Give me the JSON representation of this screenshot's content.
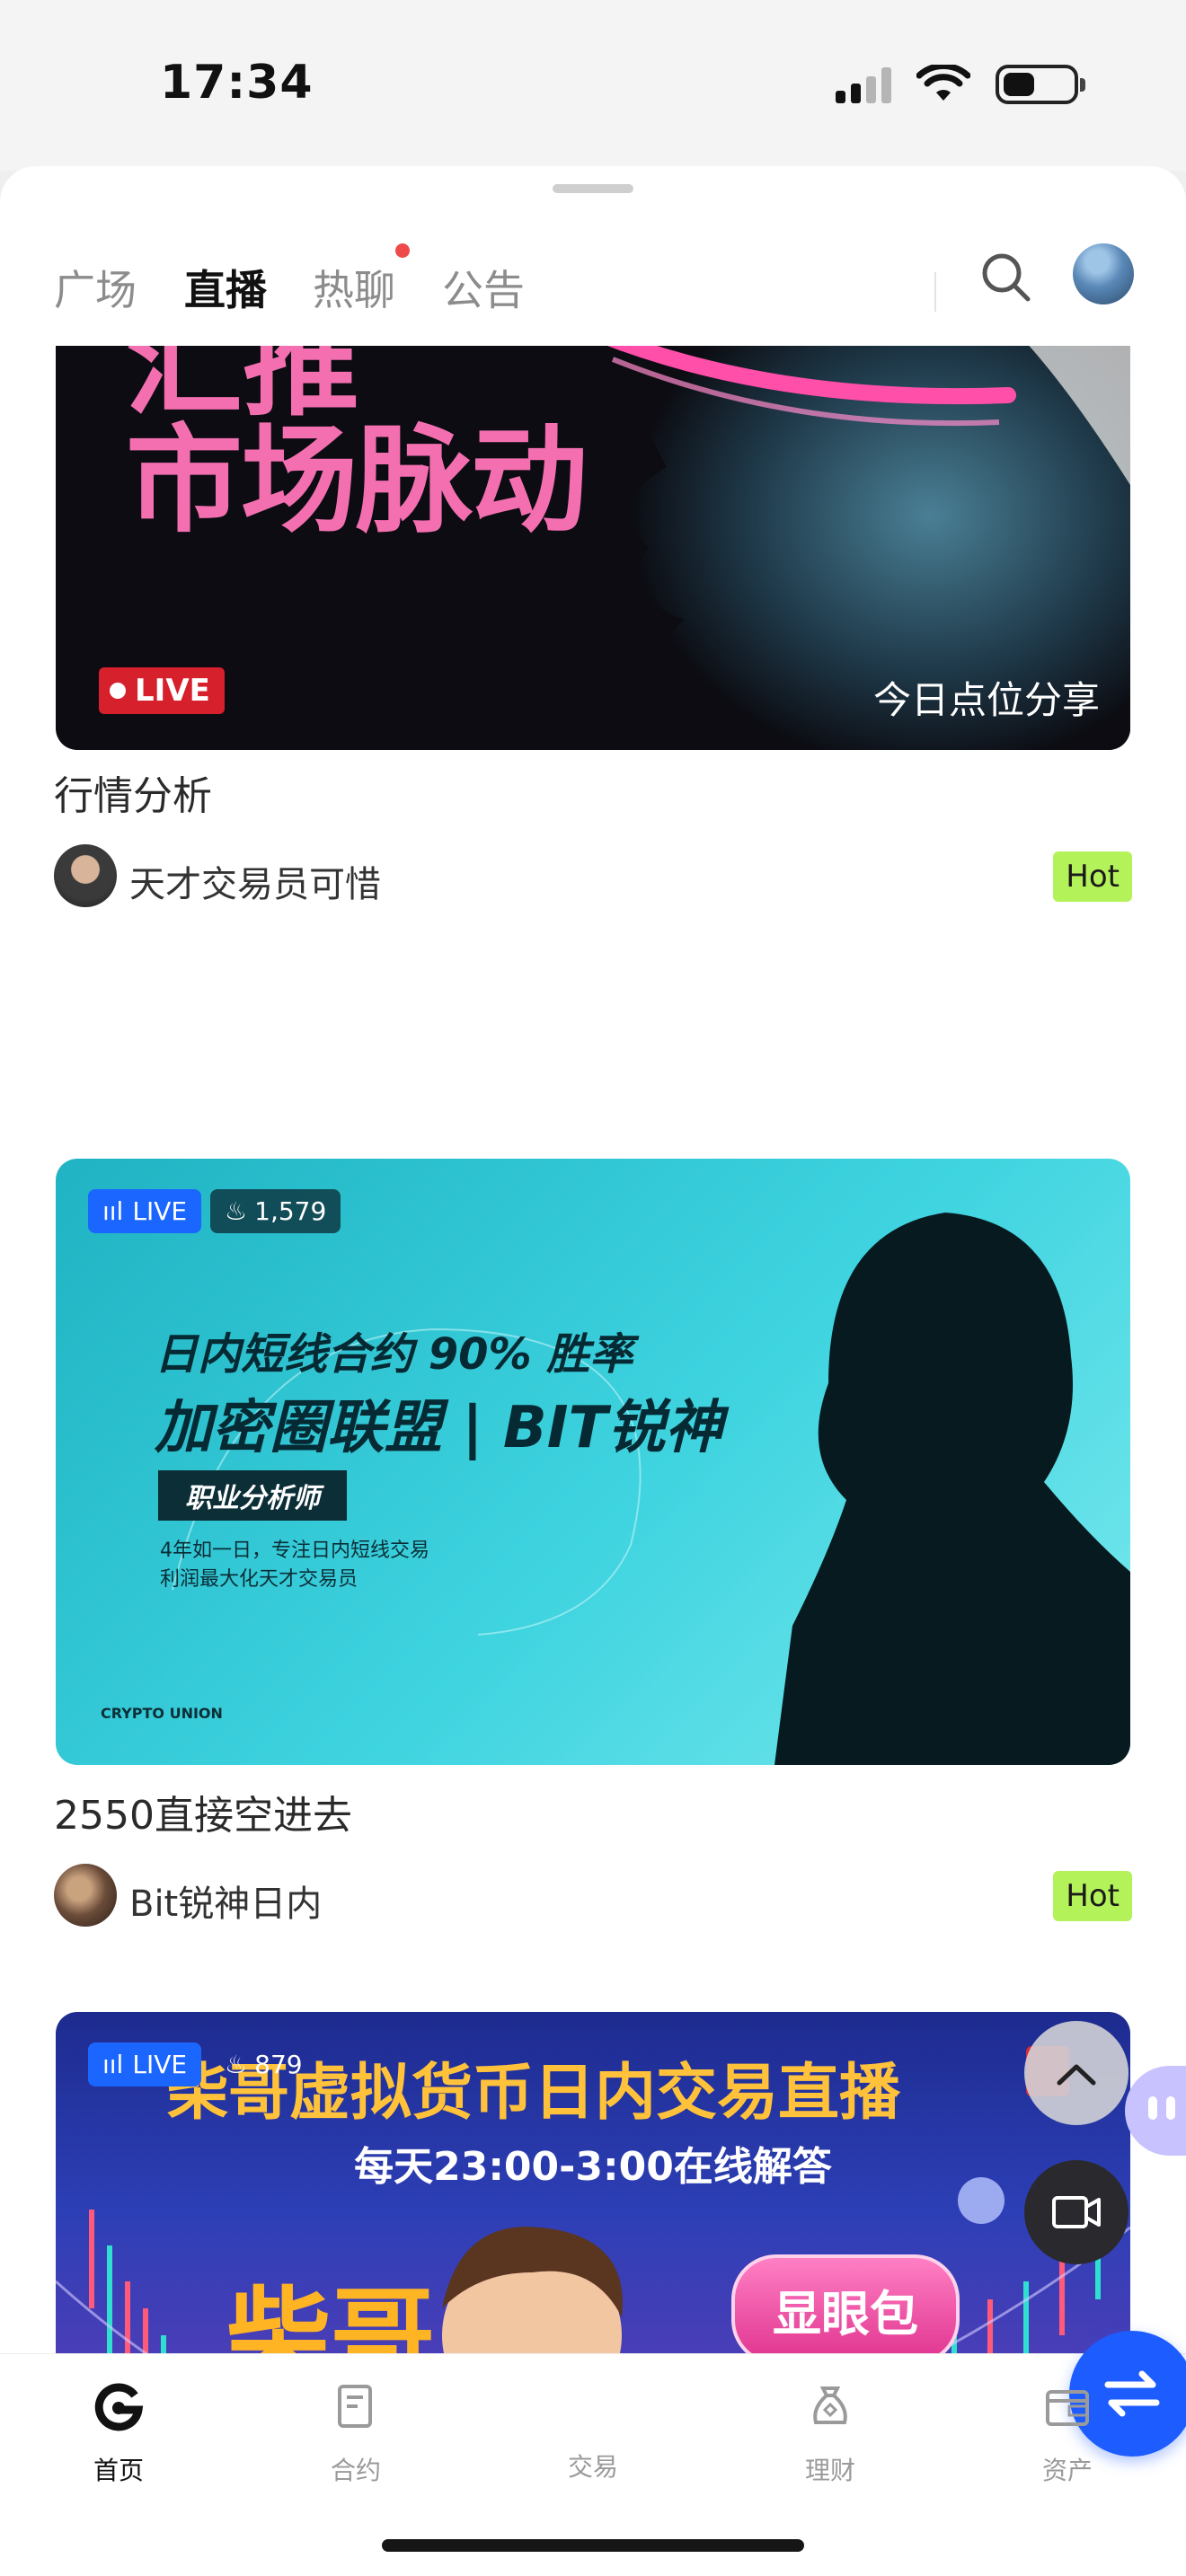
{
  "status_bar": {
    "time": "17:34"
  },
  "tabs": [
    {
      "label": "广场"
    },
    {
      "label": "直播"
    },
    {
      "label": "热聊"
    },
    {
      "label": "公告"
    }
  ],
  "cards": [
    {
      "banner_headline_top": "汇推",
      "banner_headline": "市场脉动",
      "live_label": "LIVE",
      "banner_caption": "今日点位分享",
      "title": "行情分析",
      "author": "天才交易员可惜",
      "badge": "Hot"
    },
    {
      "live_label": "LIVE",
      "viewers": "1,579",
      "banner_line1": "日内短线合约 90% 胜率",
      "banner_line2": "加密圈联盟 | BIT锐神",
      "banner_badge": "职业分析师",
      "banner_sub1": "4年如一日，专注日内短线交易",
      "banner_sub2": "利润最大化天才交易员",
      "banner_brand": "CRYPTO UNION",
      "title": "2550直接空进去",
      "author": "Bit锐神日内",
      "badge": "Hot"
    },
    {
      "live_label": "LIVE",
      "viewers": "879",
      "banner_title": "柴哥虚拟货币日内交易直播",
      "banner_subtitle": "每天23:00-3:00在线解答",
      "banner_name": "柴哥",
      "banner_tag": "显眼包"
    }
  ],
  "bottom_nav": [
    {
      "label": "首页"
    },
    {
      "label": "合约"
    },
    {
      "label": "交易"
    },
    {
      "label": "理财"
    },
    {
      "label": "资产"
    }
  ],
  "colors": {
    "accent": "#1d5cff",
    "hot": "#b4f25a",
    "live_red": "#d6202c",
    "live_blue": "#1a66ff"
  }
}
